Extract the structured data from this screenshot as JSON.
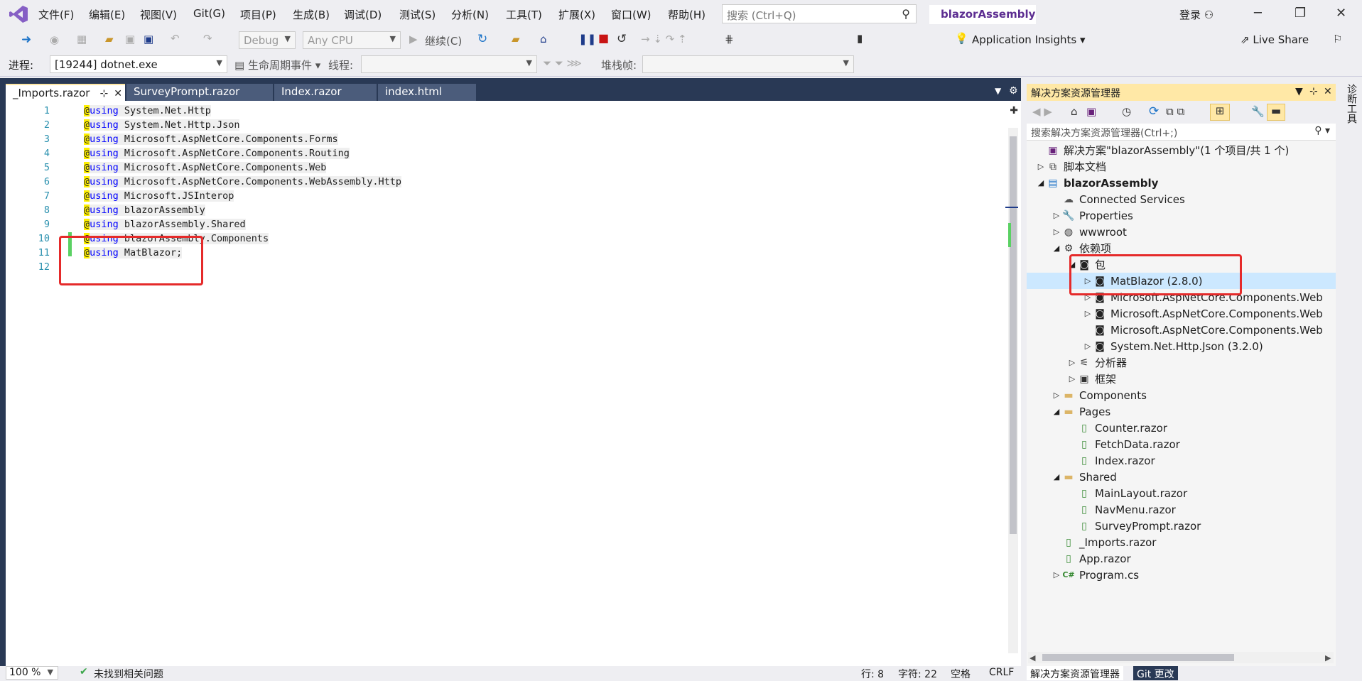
{
  "menubar": {
    "items": [
      "文件(F)",
      "编辑(E)",
      "视图(V)",
      "Git(G)",
      "项目(P)",
      "生成(B)",
      "调试(D)",
      "测试(S)",
      "分析(N)",
      "工具(T)",
      "扩展(X)",
      "窗口(W)",
      "帮助(H)"
    ],
    "search_placeholder": "搜索 (Ctrl+Q)",
    "solution_name": "blazorAssembly",
    "signin": "登录"
  },
  "toolbar": {
    "config": "Debug",
    "platform": "Any CPU",
    "continue": "继续(C)",
    "app_insights": "Application Insights",
    "live_share": "Live Share",
    "process_label": "进程:",
    "process_value": "[19244] dotnet.exe",
    "lifecycle": "生命周期事件",
    "thread_label": "线程:",
    "stack_label": "堆栈帧:"
  },
  "tabs": [
    {
      "label": "_Imports.razor",
      "active": true
    },
    {
      "label": "SurveyPrompt.razor",
      "active": false
    },
    {
      "label": "Index.razor",
      "active": false
    },
    {
      "label": "index.html",
      "active": false
    }
  ],
  "editor": {
    "lines": [
      {
        "n": "1",
        "ns": "System.Net.Http"
      },
      {
        "n": "2",
        "ns": "System.Net.Http.Json"
      },
      {
        "n": "3",
        "ns": "Microsoft.AspNetCore.Components.Forms"
      },
      {
        "n": "4",
        "ns": "Microsoft.AspNetCore.Components.Routing"
      },
      {
        "n": "5",
        "ns": "Microsoft.AspNetCore.Components.Web"
      },
      {
        "n": "6",
        "ns": "Microsoft.AspNetCore.Components.WebAssembly.Http"
      },
      {
        "n": "7",
        "ns": "Microsoft.JSInterop"
      },
      {
        "n": "8",
        "ns": "blazorAssembly"
      },
      {
        "n": "9",
        "ns": "blazorAssembly.Shared"
      },
      {
        "n": "10",
        "ns": "blazorAssembly.Components"
      },
      {
        "n": "11",
        "ns": "MatBlazor;"
      },
      {
        "n": "12",
        "ns": ""
      }
    ],
    "at": "@",
    "kw": "using"
  },
  "editor_status": {
    "zoom": "100 %",
    "issues": "未找到相关问题",
    "line": "行: 8",
    "col": "字符: 22",
    "space": "空格",
    "eol": "CRLF"
  },
  "solution_explorer": {
    "title": "解决方案资源管理器",
    "search_placeholder": "搜索解决方案资源管理器(Ctrl+;)",
    "nodes": [
      {
        "label": "解决方案\"blazorAssembly\"(1 个项目/共 1 个)",
        "depth": 0,
        "exp": "",
        "icon": "solution-icon",
        "glyph": "▣",
        "color": "#68217a"
      },
      {
        "label": "脚本文档",
        "depth": 0,
        "exp": "▷",
        "icon": "script-docs-icon",
        "glyph": "⧉",
        "color": "#333"
      },
      {
        "label": "blazorAssembly",
        "depth": 0,
        "exp": "◢",
        "icon": "project-icon",
        "glyph": "▤",
        "color": "#1e74c8",
        "bold": true
      },
      {
        "label": "Connected Services",
        "depth": 1,
        "exp": "",
        "icon": "connected-services-icon",
        "glyph": "☁",
        "color": "#555"
      },
      {
        "label": "Properties",
        "depth": 1,
        "exp": "▷",
        "icon": "properties-icon",
        "glyph": "🔧",
        "color": "#555"
      },
      {
        "label": "wwwroot",
        "depth": 1,
        "exp": "▷",
        "icon": "globe-icon",
        "glyph": "◍",
        "color": "#333"
      },
      {
        "label": "依赖项",
        "depth": 1,
        "exp": "◢",
        "icon": "dependencies-icon",
        "glyph": "⚙",
        "color": "#333"
      },
      {
        "label": "包",
        "depth": 2,
        "exp": "◢",
        "icon": "package-icon",
        "glyph": "◙",
        "color": "#222"
      },
      {
        "label": "MatBlazor (2.8.0)",
        "depth": 3,
        "exp": "▷",
        "icon": "package-icon",
        "glyph": "◙",
        "color": "#222",
        "selected": true
      },
      {
        "label": "Microsoft.AspNetCore.Components.Web",
        "depth": 3,
        "exp": "▷",
        "icon": "package-icon",
        "glyph": "◙",
        "color": "#222"
      },
      {
        "label": "Microsoft.AspNetCore.Components.Web",
        "depth": 3,
        "exp": "▷",
        "icon": "package-icon",
        "glyph": "◙",
        "color": "#222"
      },
      {
        "label": "Microsoft.AspNetCore.Components.Web",
        "depth": 3,
        "exp": "",
        "icon": "package-icon",
        "glyph": "◙",
        "color": "#222"
      },
      {
        "label": "System.Net.Http.Json (3.2.0)",
        "depth": 3,
        "exp": "▷",
        "icon": "package-icon",
        "glyph": "◙",
        "color": "#222"
      },
      {
        "label": "分析器",
        "depth": 2,
        "exp": "▷",
        "icon": "analyzer-icon",
        "glyph": "⚟",
        "color": "#333"
      },
      {
        "label": "框架",
        "depth": 2,
        "exp": "▷",
        "icon": "framework-icon",
        "glyph": "▣",
        "color": "#333"
      },
      {
        "label": "Components",
        "depth": 1,
        "exp": "▷",
        "icon": "folder-icon",
        "glyph": "▬",
        "color": "#dcb567"
      },
      {
        "label": "Pages",
        "depth": 1,
        "exp": "◢",
        "icon": "folder-icon",
        "glyph": "▬",
        "color": "#dcb567"
      },
      {
        "label": "Counter.razor",
        "depth": 2,
        "exp": "",
        "icon": "razor-file-icon",
        "glyph": "▯",
        "color": "#388a34"
      },
      {
        "label": "FetchData.razor",
        "depth": 2,
        "exp": "",
        "icon": "razor-file-icon",
        "glyph": "▯",
        "color": "#388a34"
      },
      {
        "label": "Index.razor",
        "depth": 2,
        "exp": "",
        "icon": "razor-file-icon",
        "glyph": "▯",
        "color": "#388a34"
      },
      {
        "label": "Shared",
        "depth": 1,
        "exp": "◢",
        "icon": "folder-icon",
        "glyph": "▬",
        "color": "#dcb567"
      },
      {
        "label": "MainLayout.razor",
        "depth": 2,
        "exp": "",
        "icon": "razor-file-icon",
        "glyph": "▯",
        "color": "#388a34"
      },
      {
        "label": "NavMenu.razor",
        "depth": 2,
        "exp": "",
        "icon": "razor-file-icon",
        "glyph": "▯",
        "color": "#388a34"
      },
      {
        "label": "SurveyPrompt.razor",
        "depth": 2,
        "exp": "",
        "icon": "razor-file-icon",
        "glyph": "▯",
        "color": "#388a34"
      },
      {
        "label": "_Imports.razor",
        "depth": 1,
        "exp": "",
        "icon": "razor-file-icon",
        "glyph": "▯",
        "color": "#388a34"
      },
      {
        "label": "App.razor",
        "depth": 1,
        "exp": "",
        "icon": "razor-file-icon",
        "glyph": "▯",
        "color": "#388a34"
      },
      {
        "label": "Program.cs",
        "depth": 1,
        "exp": "▷",
        "icon": "csharp-file-icon",
        "glyph": "C#",
        "color": "#388a34"
      }
    ],
    "tabs": [
      "解决方案资源管理器",
      "Git 更改"
    ]
  },
  "right_rail": {
    "label": "诊断工具"
  }
}
